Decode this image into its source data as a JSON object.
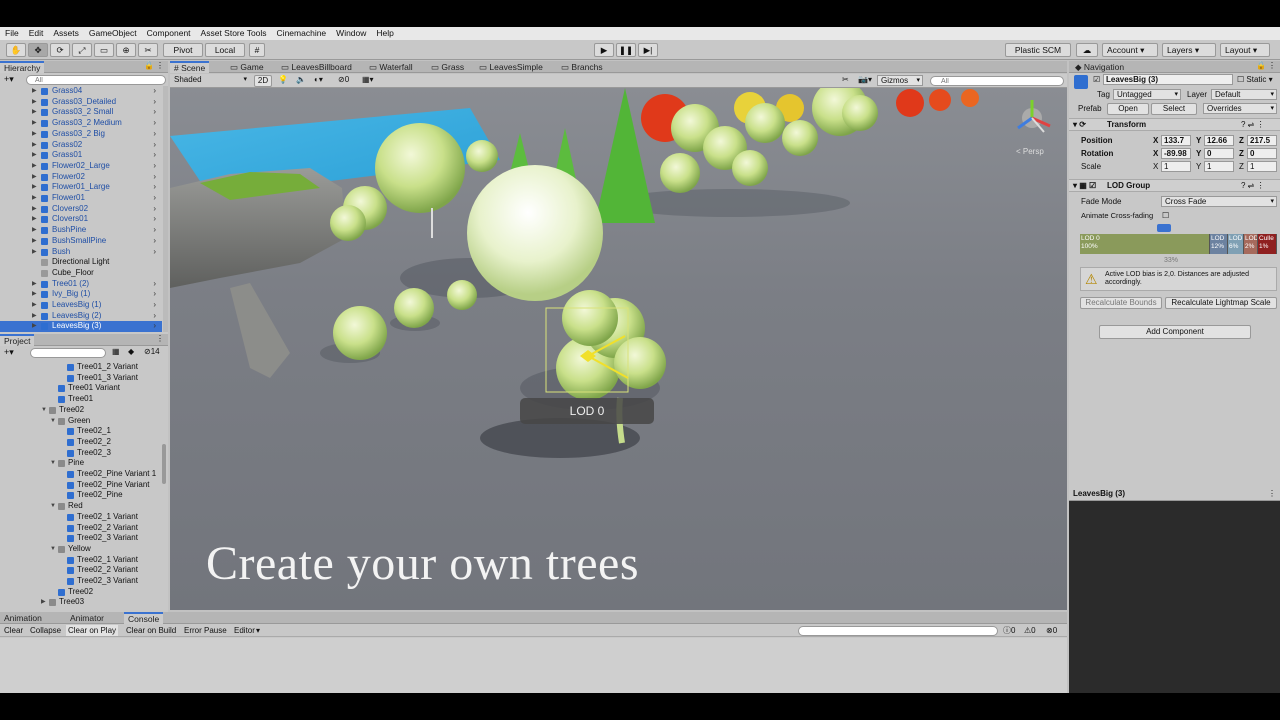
{
  "menu": [
    "File",
    "Edit",
    "Assets",
    "GameObject",
    "Component",
    "Asset Store Tools",
    "Cinemachine",
    "Window",
    "Help"
  ],
  "toolbar": {
    "pivot": "Pivot",
    "local": "Local",
    "plastic": "Plastic SCM",
    "account": "Account",
    "layers": "Layers",
    "layout": "Layout"
  },
  "hierarchy": {
    "title": "Hierarchy",
    "search_placeholder": "All",
    "items": [
      {
        "label": "Grass04",
        "kind": "prefab"
      },
      {
        "label": "Grass03_Detailed",
        "kind": "prefab"
      },
      {
        "label": "Grass03_2 Small",
        "kind": "prefab"
      },
      {
        "label": "Grass03_2 Medium",
        "kind": "prefab"
      },
      {
        "label": "Grass03_2 Big",
        "kind": "prefab"
      },
      {
        "label": "Grass02",
        "kind": "prefab"
      },
      {
        "label": "Grass01",
        "kind": "prefab"
      },
      {
        "label": "Flower02_Large",
        "kind": "prefab"
      },
      {
        "label": "Flower02",
        "kind": "prefab"
      },
      {
        "label": "Flower01_Large",
        "kind": "prefab"
      },
      {
        "label": "Flower01",
        "kind": "prefab"
      },
      {
        "label": "Clovers02",
        "kind": "prefab"
      },
      {
        "label": "Clovers01",
        "kind": "prefab"
      },
      {
        "label": "BushPine",
        "kind": "prefab"
      },
      {
        "label": "BushSmallPine",
        "kind": "prefab"
      },
      {
        "label": "Bush",
        "kind": "prefab"
      },
      {
        "label": "Directional Light",
        "kind": "plain"
      },
      {
        "label": "Cube_Floor",
        "kind": "plain"
      },
      {
        "label": "Tree01 (2)",
        "kind": "prefab"
      },
      {
        "label": "Ivy_Big (1)",
        "kind": "prefab"
      },
      {
        "label": "LeavesBig (1)",
        "kind": "prefab"
      },
      {
        "label": "LeavesBig (2)",
        "kind": "prefab"
      },
      {
        "label": "LeavesBig (3)",
        "kind": "prefab",
        "selected": true
      }
    ]
  },
  "project": {
    "title": "Project",
    "count": "14",
    "items": [
      {
        "label": "Tree01_2 Variant",
        "indent": 3
      },
      {
        "label": "Tree01_3 Variant",
        "indent": 3
      },
      {
        "label": "Tree01 Variant",
        "indent": 2
      },
      {
        "label": "Tree01",
        "indent": 2
      },
      {
        "label": "Tree02",
        "indent": 1,
        "folder": true
      },
      {
        "label": "Green",
        "indent": 2,
        "folder": true
      },
      {
        "label": "Tree02_1",
        "indent": 3
      },
      {
        "label": "Tree02_2",
        "indent": 3
      },
      {
        "label": "Tree02_3",
        "indent": 3
      },
      {
        "label": "Pine",
        "indent": 2,
        "folder": true
      },
      {
        "label": "Tree02_Pine Variant 1",
        "indent": 3
      },
      {
        "label": "Tree02_Pine Variant",
        "indent": 3
      },
      {
        "label": "Tree02_Pine",
        "indent": 3
      },
      {
        "label": "Red",
        "indent": 2,
        "folder": true
      },
      {
        "label": "Tree02_1 Variant",
        "indent": 3
      },
      {
        "label": "Tree02_2 Variant",
        "indent": 3
      },
      {
        "label": "Tree02_3 Variant",
        "indent": 3
      },
      {
        "label": "Yellow",
        "indent": 2,
        "folder": true
      },
      {
        "label": "Tree02_1 Variant",
        "indent": 3
      },
      {
        "label": "Tree02_2 Variant",
        "indent": 3
      },
      {
        "label": "Tree02_3 Variant",
        "indent": 3
      },
      {
        "label": "Tree02",
        "indent": 2
      },
      {
        "label": "Tree03",
        "indent": 1,
        "folder": true,
        "collapsed": true
      }
    ]
  },
  "scene_tabs": [
    "Scene",
    "Game",
    "LeavesBillboard",
    "Waterfall",
    "Grass",
    "LeavesSimple",
    "Branchs"
  ],
  "scene_toolbar": {
    "shading": "Shaded",
    "mode2d": "2D",
    "hidden_count": "0",
    "gizmos": "Gizmos",
    "search_placeholder": "All"
  },
  "scene": {
    "persp_label": "< Persp",
    "lod_label": "LOD 0",
    "caption": "Create your own trees"
  },
  "bottom": {
    "tabs": [
      "Animation",
      "Animator",
      "Console"
    ],
    "buttons": [
      "Clear",
      "Collapse",
      "Clear on Play",
      "Clear on Build",
      "Error Pause",
      "Editor"
    ],
    "counts": [
      "0",
      "0",
      "0"
    ]
  },
  "inspector": {
    "tab": "Navigation",
    "object_name": "LeavesBig (3)",
    "static_label": "Static",
    "tag_label": "Tag",
    "tag_value": "Untagged",
    "layer_label": "Layer",
    "layer_value": "Default",
    "prefab_label": "Prefab",
    "open": "Open",
    "select": "Select",
    "overrides": "Overrides",
    "transform": {
      "title": "Transform",
      "position_label": "Position",
      "rotation_label": "Rotation",
      "scale_label": "Scale",
      "px": "133.7",
      "py": "12.66",
      "pz": "217.5",
      "rx": "-89.98",
      "ry": "0",
      "rz": "0",
      "sx": "1",
      "sy": "1",
      "sz": "1"
    },
    "lod": {
      "title": "LOD Group",
      "fade_mode_label": "Fade Mode",
      "fade_mode_value": "Cross Fade",
      "animate_label": "Animate Cross-fading",
      "bars": [
        {
          "name": "LOD 0",
          "pct": "100%",
          "color": "#8a9a5b"
        },
        {
          "name": "LOD",
          "pct": "12%",
          "color": "#6c82a0"
        },
        {
          "name": "LOD",
          "pct": "6%",
          "color": "#7fa0b4"
        },
        {
          "name": "LOD",
          "pct": "2%",
          "color": "#a66a5c"
        },
        {
          "name": "Culle",
          "pct": "1%",
          "color": "#8f2020"
        }
      ],
      "marker": "33%",
      "warning": "Active LOD bias is 2,0. Distances are adjusted accordingly.",
      "recalc_bounds": "Recalculate Bounds",
      "recalc_lightmap": "Recalculate Lightmap Scale"
    },
    "add_component": "Add Component",
    "preview_title": "LeavesBig (3)"
  }
}
